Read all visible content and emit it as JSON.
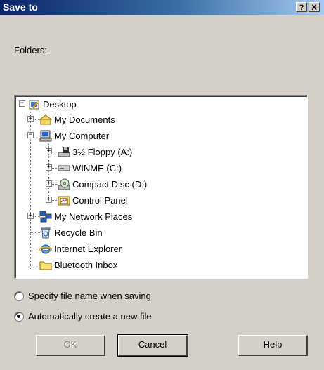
{
  "dialog": {
    "title": "Save to",
    "help_button": "?",
    "close_button": "X",
    "folders_label": "Folders:"
  },
  "tree": {
    "items": [
      {
        "label": "Desktop",
        "expander": "−",
        "icon": "desktop-icon"
      },
      {
        "label": "My Documents",
        "expander": "+",
        "icon": "my-documents-icon"
      },
      {
        "label": "My Computer",
        "expander": "−",
        "icon": "my-computer-icon"
      },
      {
        "label": "3½ Floppy (A:)",
        "expander": "+",
        "icon": "floppy-drive-icon"
      },
      {
        "label": "WINME (C:)",
        "expander": "+",
        "icon": "hard-drive-icon"
      },
      {
        "label": "Compact Disc (D:)",
        "expander": "+",
        "icon": "cd-drive-icon"
      },
      {
        "label": "Control Panel",
        "expander": "+",
        "icon": "control-panel-icon"
      },
      {
        "label": "My Network Places",
        "expander": "+",
        "icon": "network-places-icon"
      },
      {
        "label": "Recycle Bin",
        "expander": "",
        "icon": "recycle-bin-icon"
      },
      {
        "label": "Internet Explorer",
        "expander": "",
        "icon": "internet-explorer-icon"
      },
      {
        "label": "Bluetooth Inbox",
        "expander": "",
        "icon": "folder-icon"
      }
    ]
  },
  "options": {
    "specify_label": "Specify file name when saving",
    "auto_label": "Automatically create a new file",
    "selected": "auto"
  },
  "buttons": {
    "ok": "OK",
    "cancel": "Cancel",
    "help": "Help"
  }
}
